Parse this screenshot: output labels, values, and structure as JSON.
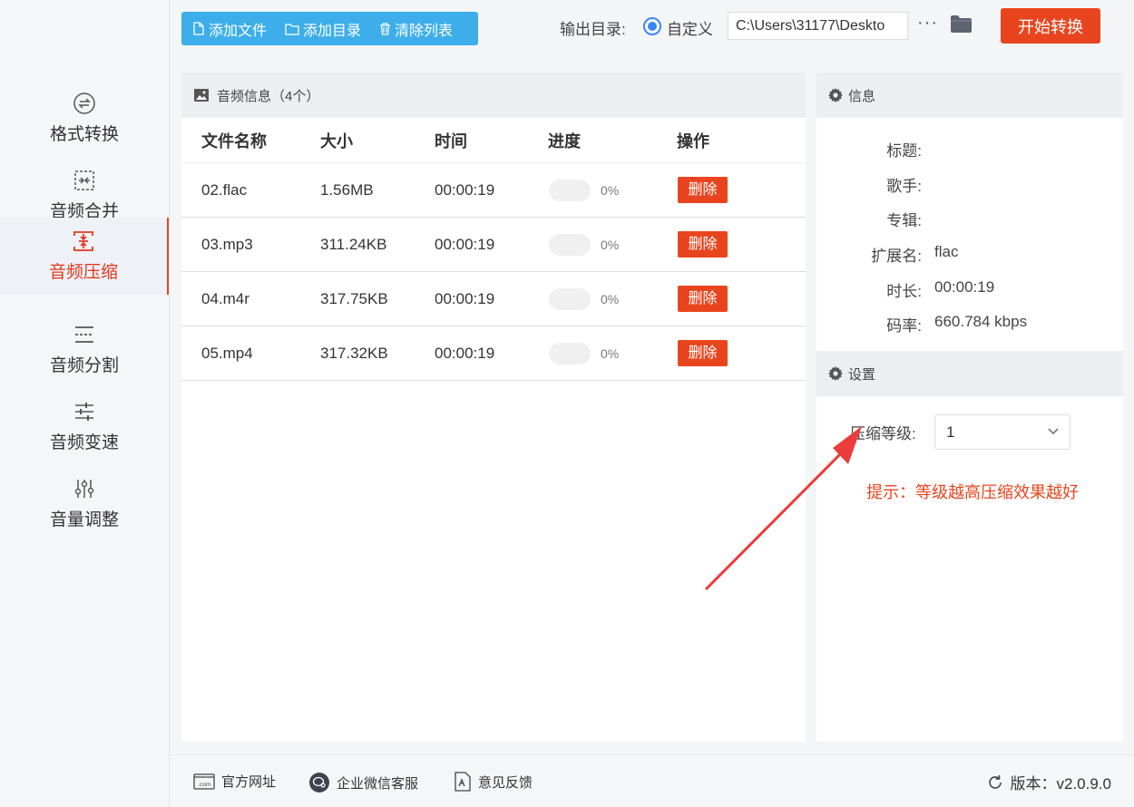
{
  "sidebar": {
    "items": [
      {
        "label": "格式转换",
        "icon": "swap-circle-icon"
      },
      {
        "label": "音频合并",
        "icon": "merge-icon"
      },
      {
        "label": "音频压缩",
        "icon": "compress-icon",
        "active": true
      },
      {
        "label": "音频分割",
        "icon": "split-icon"
      },
      {
        "label": "音频变速",
        "icon": "speed-sliders-icon"
      },
      {
        "label": "音量调整",
        "icon": "volume-sliders-icon"
      }
    ]
  },
  "toolbar": {
    "add_file": "添加文件",
    "add_dir": "添加目录",
    "clear_list": "清除列表",
    "output_label": "输出目录:",
    "custom_label": "自定义",
    "output_path": "C:\\Users\\31177\\Deskto",
    "more": "···",
    "start": "开始转换"
  },
  "file_list": {
    "title": "音频信息（4个）",
    "columns": [
      "文件名称",
      "大小",
      "时间",
      "进度",
      "操作"
    ],
    "rows": [
      {
        "name": "02.flac",
        "size": "1.56MB",
        "time": "00:00:19",
        "progress": 0,
        "progress_text": "0%",
        "action": "删除"
      },
      {
        "name": "03.mp3",
        "size": "311.24KB",
        "time": "00:00:19",
        "progress": 0,
        "progress_text": "0%",
        "action": "删除"
      },
      {
        "name": "04.m4r",
        "size": "317.75KB",
        "time": "00:00:19",
        "progress": 0,
        "progress_text": "0%",
        "action": "删除"
      },
      {
        "name": "05.mp4",
        "size": "317.32KB",
        "time": "00:00:19",
        "progress": 0,
        "progress_text": "0%",
        "action": "删除"
      }
    ]
  },
  "info": {
    "title": "信息",
    "fields": [
      {
        "label": "标题:",
        "value": ""
      },
      {
        "label": "歌手:",
        "value": ""
      },
      {
        "label": "专辑:",
        "value": ""
      },
      {
        "label": "扩展名:",
        "value": "flac"
      },
      {
        "label": "时长:",
        "value": "00:00:19"
      },
      {
        "label": "码率:",
        "value": "660.784 kbps"
      }
    ]
  },
  "settings": {
    "title": "设置",
    "level_label": "压缩等级:",
    "level_value": "1",
    "tip": "提示：等级越高压缩效果越好"
  },
  "footer": {
    "website": "官方网址",
    "wechat": "企业微信客服",
    "feedback": "意见反馈",
    "version": "版本：v2.0.9.0"
  },
  "colors": {
    "accent_blue": "#3daee9",
    "accent_red": "#e8451e",
    "radio_blue": "#3a86f5"
  }
}
